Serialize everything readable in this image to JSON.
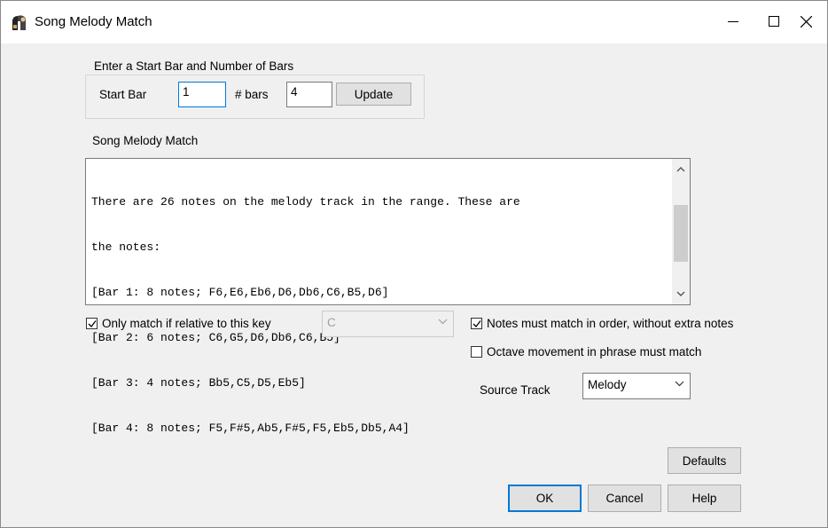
{
  "window": {
    "title": "Song Melody Match"
  },
  "range_group": {
    "legend": "Enter a Start Bar and Number of Bars",
    "start_bar_label": "Start Bar",
    "start_bar_value": "1",
    "bars_label": "# bars",
    "bars_value": "4",
    "update_label": "Update"
  },
  "output": {
    "label": "Song Melody Match",
    "lines": [
      "There are 26 notes on the melody track in the range. These are",
      "the notes:",
      "[Bar 1: 8 notes; F6,E6,Eb6,D6,Db6,C6,B5,D6]",
      "[Bar 2: 6 notes; C6,G5,D6,Db6,C6,B5]",
      "[Bar 3: 4 notes; Bb5,C5,D5,Eb5]",
      "[Bar 4: 8 notes; F5,F#5,Ab5,F#5,F5,Eb5,Db5,A4]"
    ]
  },
  "options": {
    "relative_key_label": "Only match if relative to this  key",
    "relative_key_checked": true,
    "key_value": "C",
    "in_order_label": "Notes must match in order, without extra notes",
    "in_order_checked": true,
    "octave_label": "Octave movement in phrase must match",
    "octave_checked": false,
    "source_track_label": "Source Track",
    "source_track_value": "Melody"
  },
  "buttons": {
    "defaults": "Defaults",
    "ok": "OK",
    "cancel": "Cancel",
    "help": "Help"
  },
  "colors": {
    "accent": "#0078d7",
    "dialog_bg": "#f0f0f0",
    "button_bg": "#e1e1e1"
  },
  "icons": [
    "app-icon",
    "minimize-icon",
    "maximize-icon",
    "close-icon",
    "scroll-up-icon",
    "scroll-down-icon",
    "chevron-down-icon",
    "checkmark-icon"
  ]
}
